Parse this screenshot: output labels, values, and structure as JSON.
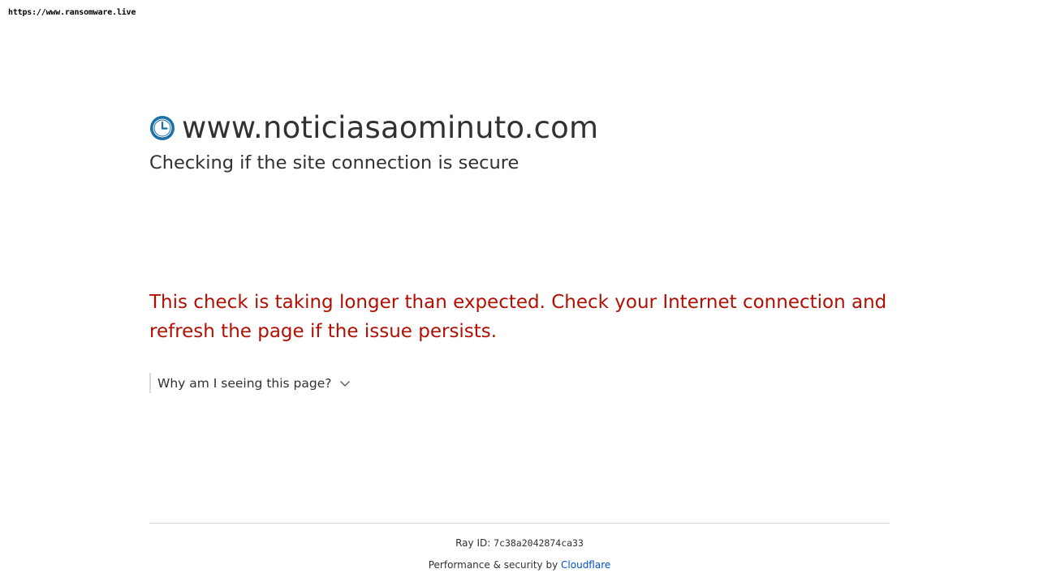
{
  "watermark": "https://www.ransomware.live",
  "header": {
    "site_name": "www.noticiasaominuto.com",
    "subtitle": "Checking if the site connection is secure",
    "icon": "clock-icon"
  },
  "message": {
    "error_text": "This check is taking longer than expected. Check your Internet connection and refresh the page if the issue persists."
  },
  "details": {
    "why_label": "Why am I seeing this page?",
    "icon": "chevron-down-icon"
  },
  "footer": {
    "ray_label": "Ray ID:",
    "ray_id": "7c38a2042874ca33",
    "performance_label": "Performance & security by",
    "cloudflare_link": "Cloudflare"
  },
  "colors": {
    "error": "#b20f03",
    "link": "#0051c3",
    "text": "#313131",
    "icon_blue": "#1a6fa8"
  }
}
